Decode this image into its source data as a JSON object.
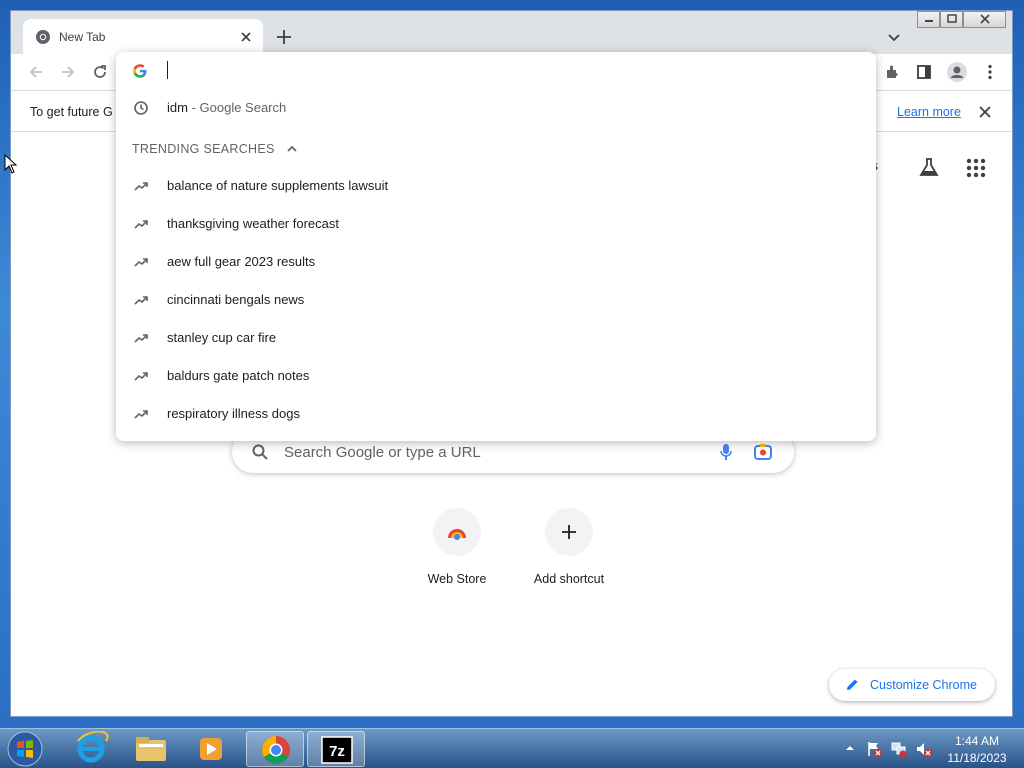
{
  "colors": {
    "accent": "#1a73e8",
    "text": "#202124",
    "muted": "#5f6368",
    "tabstrip": "#dee1e6"
  },
  "tab": {
    "title": "New Tab"
  },
  "infobar": {
    "text": "To get future G",
    "learn_more": "Learn more"
  },
  "omnibox": {
    "value": ""
  },
  "dropdown": {
    "history": {
      "query": "idm",
      "suffix": "- Google Search"
    },
    "trending_label": "TRENDING SEARCHES",
    "trending": [
      "balance of nature supplements lawsuit",
      "thanksgiving weather forecast",
      "aew full gear 2023 results",
      "cincinnati bengals news",
      "stanley cup car fire",
      "baldurs gate patch notes",
      "respiratory illness dogs"
    ]
  },
  "ntp": {
    "images_fragment": "ges",
    "search_placeholder": "Search Google or type a URL",
    "shortcuts": [
      {
        "label": "Web Store"
      },
      {
        "label": "Add shortcut"
      }
    ],
    "customize_label": "Customize Chrome"
  },
  "taskbar": {
    "time": "1:44 AM",
    "date": "11/18/2023"
  }
}
